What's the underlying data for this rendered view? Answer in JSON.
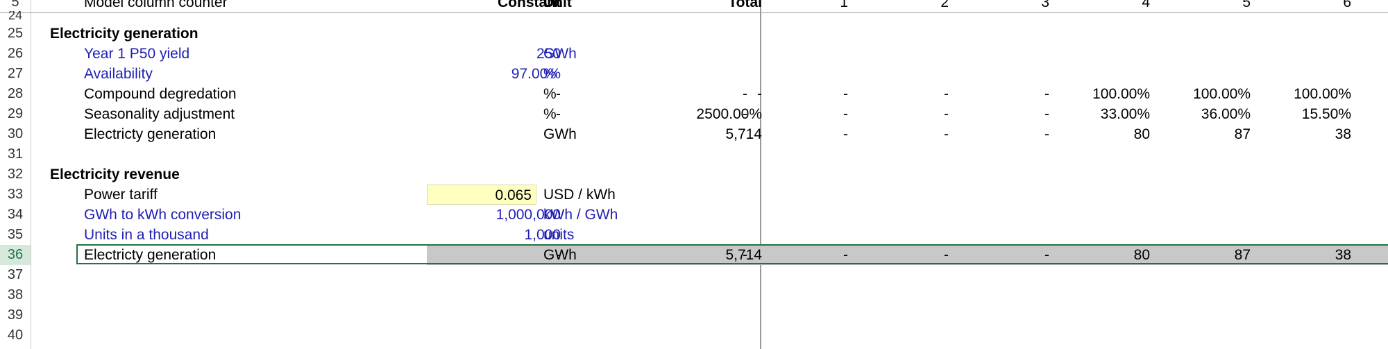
{
  "header": {
    "row_num": "5",
    "label": "Model column counter",
    "constant": "Constant",
    "unit": "Unit",
    "total": "Total",
    "periods": [
      "1",
      "2",
      "3",
      "4",
      "5",
      "6"
    ]
  },
  "rows": {
    "r24": {
      "num": "24"
    },
    "r25": {
      "num": "25",
      "label": "Electricity generation"
    },
    "r26": {
      "num": "26",
      "label": "Year 1 P50 yield",
      "constant": "250",
      "unit": "GWh"
    },
    "r27": {
      "num": "27",
      "label": "Availability",
      "constant": "97.00%",
      "unit": "%"
    },
    "r28": {
      "num": "28",
      "label": "Compound degredation",
      "constant": "-",
      "unit": "%",
      "total": "-",
      "dash": "-",
      "values": [
        "-",
        "-",
        "-",
        "100.00%",
        "100.00%",
        "100.00%"
      ]
    },
    "r29": {
      "num": "29",
      "label": "Seasonality adjustment",
      "constant": "-",
      "unit": "%",
      "total": "2500.00%",
      "dash": "-",
      "values": [
        "-",
        "-",
        "-",
        "33.00%",
        "36.00%",
        "15.50%"
      ]
    },
    "r30": {
      "num": "30",
      "label": "Electricty generation",
      "unit": "GWh",
      "total": "5,714",
      "values": [
        "-",
        "-",
        "-",
        "80",
        "87",
        "38"
      ]
    },
    "r31": {
      "num": "31"
    },
    "r32": {
      "num": "32",
      "label": "Electricity revenue"
    },
    "r33": {
      "num": "33",
      "label": "Power tariff",
      "constant": "0.065",
      "unit": "USD / kWh"
    },
    "r34": {
      "num": "34",
      "label": "GWh to kWh conversion",
      "constant": "1,000,000",
      "unit": "kWh / GWh"
    },
    "r35": {
      "num": "35",
      "label": "Units in a thousand",
      "constant": "1,000",
      "unit": "units"
    },
    "r36": {
      "num": "36",
      "label": "Electricty generation",
      "constant": "-",
      "unit": "GWh",
      "total": "5,714",
      "dash": "-",
      "values": [
        "-",
        "-",
        "-",
        "80",
        "87",
        "38"
      ]
    },
    "r37": {
      "num": "37"
    },
    "r38": {
      "num": "38"
    },
    "r39": {
      "num": "39"
    },
    "r40": {
      "num": "40"
    }
  },
  "colors": {
    "input_blue": "#1f1fb4",
    "input_yellow": "#ffffc0",
    "selection_green": "#217346",
    "gray_fill": "#c8c8c8"
  }
}
